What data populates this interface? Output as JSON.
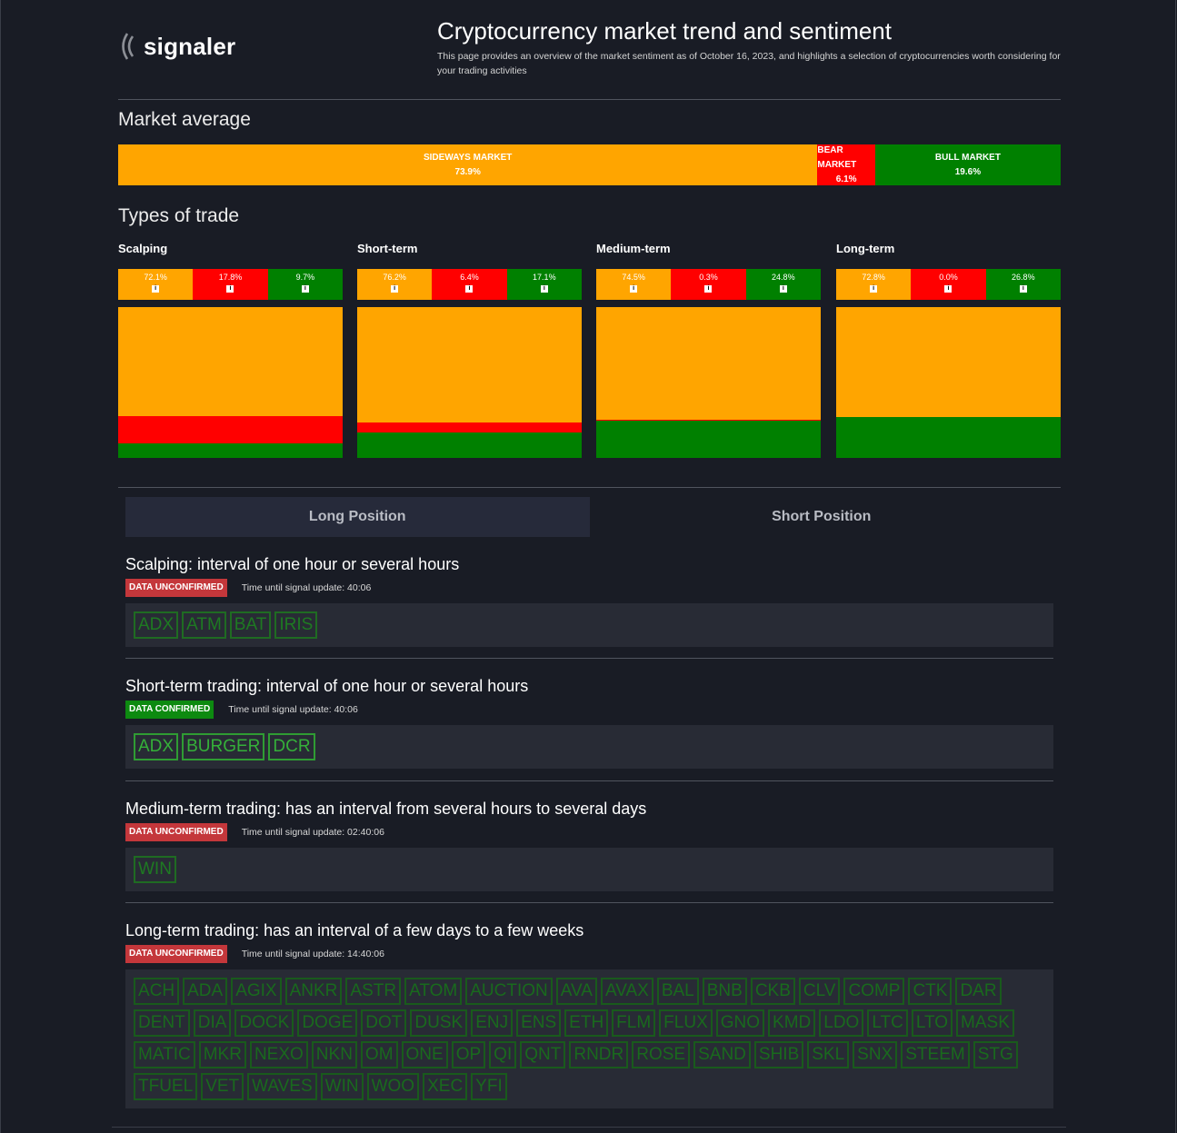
{
  "brand": {
    "name": "signaler"
  },
  "header": {
    "title": "Cryptocurrency market trend and sentiment",
    "description": "This page provides an overview of the market sentiment as of October 16, 2023, and highlights a selection of cryptocurrencies worth considering for your trading activities"
  },
  "market_average": {
    "heading": "Market average",
    "segments": [
      {
        "label": "SIDEWAYS MARKET",
        "value": "73.9%",
        "color": "#ffa500",
        "share": 0.739
      },
      {
        "label": "BEAR MARKET",
        "value": "6.1%",
        "color": "#ff0000",
        "share": 0.061
      },
      {
        "label": "BULL MARKET",
        "value": "19.6%",
        "color": "#008000",
        "share": 0.196
      }
    ]
  },
  "types_of_trade": {
    "heading": "Types of trade",
    "colors": {
      "sideways": "#ffa500",
      "bear": "#ff0000",
      "bull": "#008000"
    },
    "columns": [
      {
        "title": "Scalping",
        "values": [
          "72.1%",
          "17.8%",
          "9.7%"
        ],
        "shares": [
          0.721,
          0.178,
          0.097
        ]
      },
      {
        "title": "Short-term",
        "values": [
          "76.2%",
          "6.4%",
          "17.1%"
        ],
        "shares": [
          0.762,
          0.064,
          0.171
        ]
      },
      {
        "title": "Medium-term",
        "values": [
          "74.5%",
          "0.3%",
          "24.8%"
        ],
        "shares": [
          0.745,
          0.003,
          0.248
        ]
      },
      {
        "title": "Long-term",
        "values": [
          "72.8%",
          "0.0%",
          "26.8%"
        ],
        "shares": [
          0.728,
          0.0,
          0.268
        ]
      }
    ],
    "info_icon": "info-icon"
  },
  "tabs": [
    {
      "label": "Long Position",
      "active": true
    },
    {
      "label": "Short Position",
      "active": false
    }
  ],
  "signals": [
    {
      "title": "Scalping: interval of one hour or several hours",
      "status": "DATA UNCONFIRMED",
      "confirmed": false,
      "timer": "Time until signal update: 40:06",
      "coins": [
        "ADX",
        "ATM",
        "BAT",
        "IRIS"
      ]
    },
    {
      "title": "Short-term trading: interval of one hour or several hours",
      "status": "DATA CONFIRMED",
      "confirmed": true,
      "timer": "Time until signal update: 40:06",
      "coins": [
        "ADX",
        "BURGER",
        "DCR"
      ]
    },
    {
      "title": "Medium-term trading: has an interval from several hours to several days",
      "status": "DATA UNCONFIRMED",
      "confirmed": false,
      "timer": "Time until signal update: 02:40:06",
      "coins": [
        "WIN"
      ]
    },
    {
      "title": "Long-term trading: has an interval of a few days to a few weeks",
      "status": "DATA UNCONFIRMED",
      "confirmed": false,
      "timer": "Time until signal update: 14:40:06",
      "coins": [
        "ACH",
        "ADA",
        "AGIX",
        "ANKR",
        "ASTR",
        "ATOM",
        "AUCTION",
        "AVA",
        "AVAX",
        "BAL",
        "BNB",
        "CKB",
        "CLV",
        "COMP",
        "CTK",
        "DAR",
        "DENT",
        "DIA",
        "DOCK",
        "DOGE",
        "DOT",
        "DUSK",
        "ENJ",
        "ENS",
        "ETH",
        "FLM",
        "FLUX",
        "GNO",
        "KMD",
        "LDO",
        "LTC",
        "LTO",
        "MASK",
        "MATIC",
        "MKR",
        "NEXO",
        "NKN",
        "OM",
        "ONE",
        "OP",
        "QI",
        "QNT",
        "RNDR",
        "ROSE",
        "SAND",
        "SHIB",
        "SKL",
        "SNX",
        "STEEM",
        "STG",
        "TFUEL",
        "VET",
        "WAVES",
        "WIN",
        "WOO",
        "XEC",
        "YFI"
      ]
    }
  ]
}
